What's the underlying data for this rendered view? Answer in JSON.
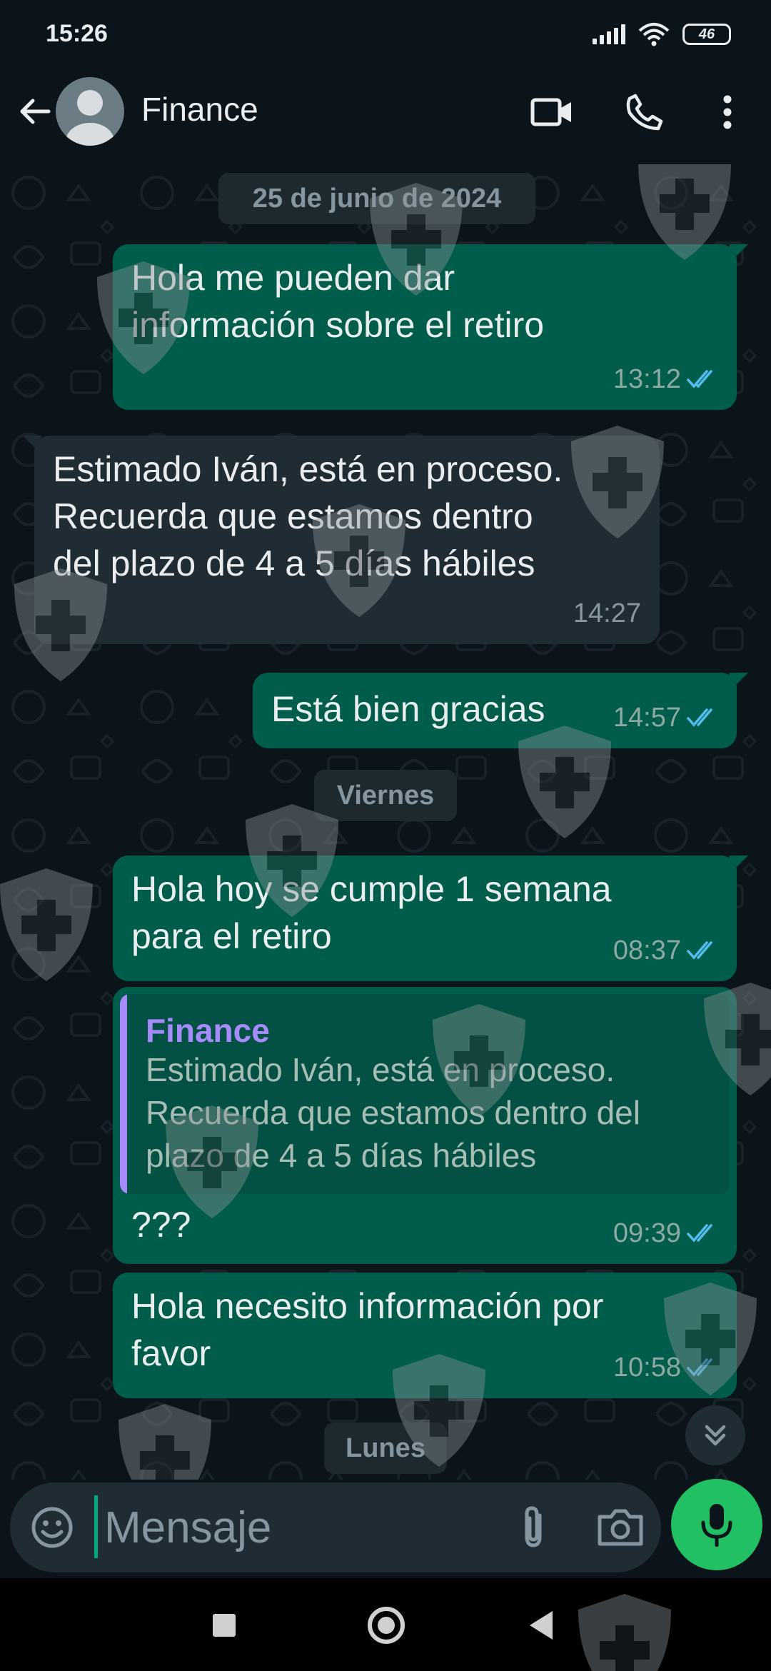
{
  "status_bar": {
    "time": "15:26",
    "battery": "46"
  },
  "header": {
    "contact_name": "Finance"
  },
  "chat": {
    "date_chips": [
      "25 de junio de 2024",
      "Viernes",
      "Lunes"
    ],
    "messages": [
      {
        "direction": "out",
        "lines": [
          "Hola me pueden dar",
          "información sobre el retiro"
        ],
        "time": "13:12",
        "status": "read"
      },
      {
        "direction": "in",
        "lines": [
          "Estimado Iván, está en proceso.",
          "Recuerda que estamos dentro",
          "del plazo de 4 a 5 días hábiles"
        ],
        "time": "14:27"
      },
      {
        "direction": "out",
        "lines": [
          "Está bien gracias"
        ],
        "time": "14:57",
        "status": "read"
      },
      {
        "direction": "out",
        "lines": [
          "Hola hoy se cumple 1 semana",
          "para el retiro"
        ],
        "time": "08:37",
        "status": "read"
      },
      {
        "direction": "out",
        "reply_to": {
          "author": "Finance",
          "lines": [
            "Estimado Iván, está en proceso.",
            "Recuerda que estamos dentro del",
            "plazo de 4 a 5 días hábiles"
          ]
        },
        "lines": [
          "???"
        ],
        "time": "09:39",
        "status": "read"
      },
      {
        "direction": "out",
        "lines": [
          "Hola necesito información por",
          "favor"
        ],
        "time": "10:58",
        "status": "read"
      }
    ]
  },
  "input": {
    "placeholder": "Mensaje"
  },
  "colors": {
    "outgoing_bubble": "#005c4b",
    "incoming_bubble": "#1f2c34",
    "accent": "#21c063",
    "read_tick": "#53bdeb",
    "quote_author": "#a78bfa"
  },
  "icons": [
    "back-arrow-icon",
    "avatar-icon",
    "video-call-icon",
    "phone-icon",
    "more-options-icon",
    "emoji-icon",
    "attach-icon",
    "camera-icon",
    "mic-icon",
    "scroll-down-icon",
    "read-ticks-icon",
    "watermark-shield-icon"
  ]
}
